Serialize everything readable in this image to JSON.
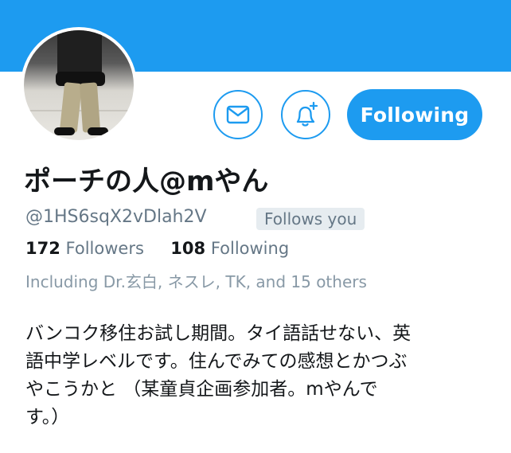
{
  "profile": {
    "display_name": "ポーチの人@mやん",
    "handle": "@1HS6sqX2vDlah2V",
    "follows_you_badge": "Follows you",
    "stats": {
      "followers_count": "172",
      "followers_label": "Followers",
      "following_count": "108",
      "following_label": "Following"
    },
    "followed_by_text": "Including Dr.玄白, ネスレ, TK, and 15 others",
    "bio_lines": [
      "バンコク移住お試し期間。タイ語話せない、英",
      "語中学レベルです。住んでみての感想とかつぶ",
      "やこうかと （某童貞企画参加者。mやんで",
      "す。）"
    ]
  },
  "actions": {
    "message_icon": "envelope-icon",
    "notifications_icon": "bell-plus-icon",
    "following_button_label": "Following"
  },
  "colors": {
    "accent": "#1d9bf0",
    "text_primary": "#14171a",
    "text_secondary": "#657786",
    "badge_bg": "#e6ecf0"
  }
}
